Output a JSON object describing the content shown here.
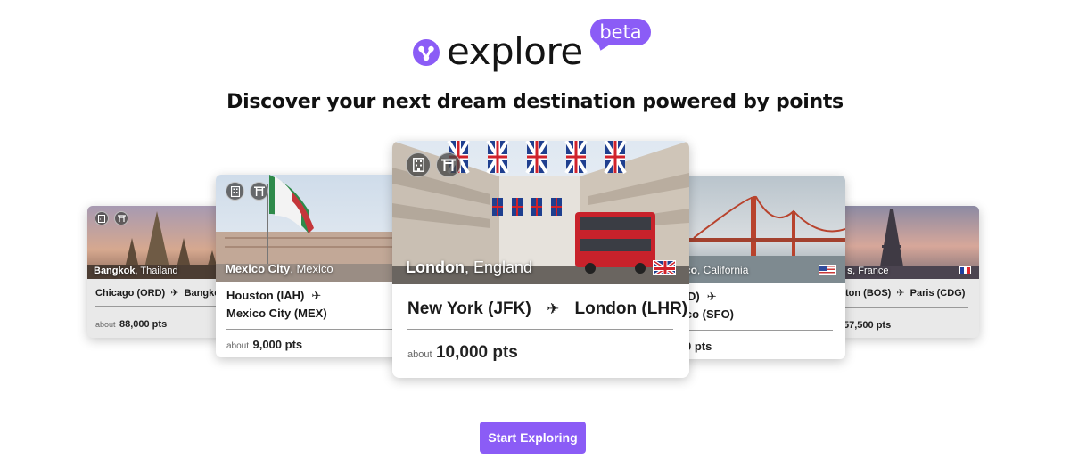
{
  "brand": {
    "name": "explore",
    "badge": "beta"
  },
  "headline": "Discover your next dream destination powered by points",
  "cards": {
    "bangkok": {
      "city": "Bangkok",
      "country": ", Thailand",
      "from": "Chicago (ORD)",
      "to": "Bangkok",
      "about": "about",
      "points": "88,000 pts"
    },
    "mexico": {
      "city": "Mexico City",
      "country": ", Mexico",
      "from": "Houston (IAH)",
      "to": "Mexico City (MEX)",
      "about": "about",
      "points": "9,000 pts"
    },
    "london": {
      "city": "London",
      "country": ", England",
      "from": "New York (JFK)",
      "to": "London (LHR)",
      "about": "about",
      "points": "10,000 pts"
    },
    "sanfrancisco": {
      "city": "isco",
      "country": ", California",
      "from": "IAD)",
      "to": "isco (SFO)",
      "points": "0 pts"
    },
    "paris": {
      "city": "s",
      "country": ", France",
      "from": "ton (BOS)",
      "to": "Paris (CDG)",
      "points": "57,500 pts"
    }
  },
  "cta": {
    "label": "Start Exploring"
  },
  "colors": {
    "accent": "#8b5cf6"
  },
  "icons": [
    "explore-logo-icon",
    "hotel-icon",
    "landmark-icon",
    "plane-icon",
    "uk-flag-icon",
    "us-flag-icon",
    "france-flag-icon"
  ]
}
